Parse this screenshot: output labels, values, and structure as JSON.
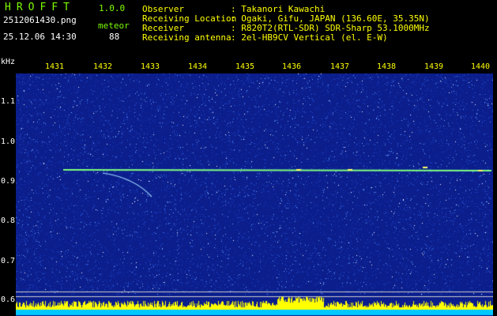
{
  "app": {
    "logo": "HROFFT",
    "version": "1.0.0"
  },
  "file": {
    "name": "2512061430.png",
    "datetime": "25.12.06 14:30"
  },
  "detection": {
    "label": "meteor",
    "count": "88"
  },
  "info": {
    "observer_label": "Observer",
    "observer_value": ": Takanori Kawachi",
    "location_label": "Receiving Location",
    "location_value": ": Ogaki, Gifu, JAPAN (136.60E, 35.35N)",
    "receiver_label": "Receiver",
    "receiver_value": ": R820T2(RTL-SDR) SDR-Sharp 53.1000MHz",
    "antenna_label": "Receiving antenna",
    "antenna_value": ": 2el-HB9CV Vertical (el. E-W)"
  },
  "axes": {
    "y_unit": "kHz",
    "y_ticks": [
      "1.1",
      "1.0",
      "0.9",
      "0.8",
      "0.7",
      "0.6"
    ],
    "x_ticks": [
      "1431",
      "1432",
      "1433",
      "1434",
      "1435",
      "1436",
      "1437",
      "1438",
      "1439",
      "1440"
    ]
  },
  "colors": {
    "spectrum_bg": "#0b1e8c",
    "carrier": "#7fff7f",
    "meteor": "#9fd8ff",
    "level": "#ffff00",
    "level_base": "#00c8ff"
  }
}
